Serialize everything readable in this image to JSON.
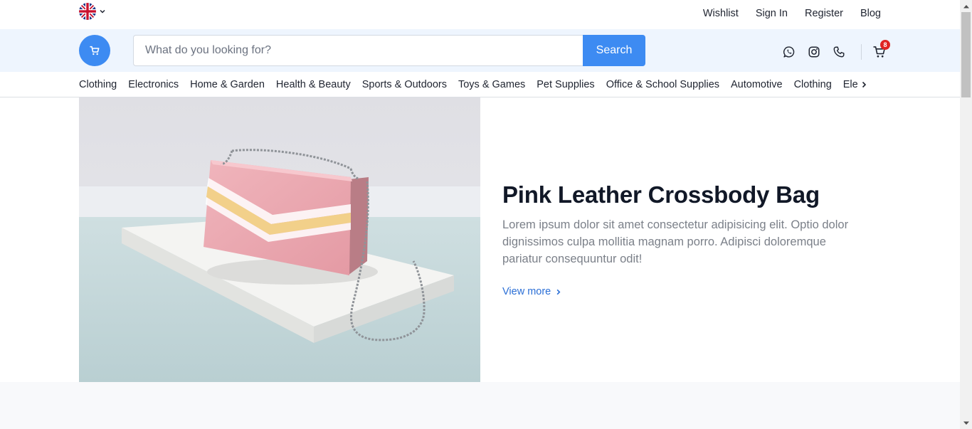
{
  "language": {
    "icon": "uk-flag-icon",
    "caret_icon": "chevron-down-icon"
  },
  "top_links": [
    "Wishlist",
    "Sign In",
    "Register",
    "Blog"
  ],
  "header": {
    "logo_icon": "cart-icon",
    "search": {
      "placeholder": "What do you looking for?",
      "value": "",
      "button_label": "Search"
    },
    "icons": [
      "whatsapp-icon",
      "instagram-icon",
      "phone-icon"
    ],
    "cart": {
      "icon": "cart-icon",
      "count": "8"
    }
  },
  "categories": [
    "Clothing",
    "Electronics",
    "Home & Garden",
    "Health & Beauty",
    "Sports & Outdoors",
    "Toys & Games",
    "Pet Supplies",
    "Office & School Supplies",
    "Automotive",
    "Clothing",
    "Electronics"
  ],
  "hero": {
    "image": "pink-leather-crossbody-bag-photo",
    "title": "Pink Leather Crossbody Bag",
    "description": "Lorem ipsum dolor sit amet consectetur adipisicing elit. Optio dolor dignissimos culpa mollitia magnam porro. Adipisci doloremque pariatur consequuntur odit!",
    "link_label": "View more"
  },
  "colors": {
    "accent": "#3d8bf2",
    "header_bg": "#eef5fe",
    "link": "#2b6fd6",
    "badge": "#e02424",
    "body_text": "#7b8089"
  }
}
